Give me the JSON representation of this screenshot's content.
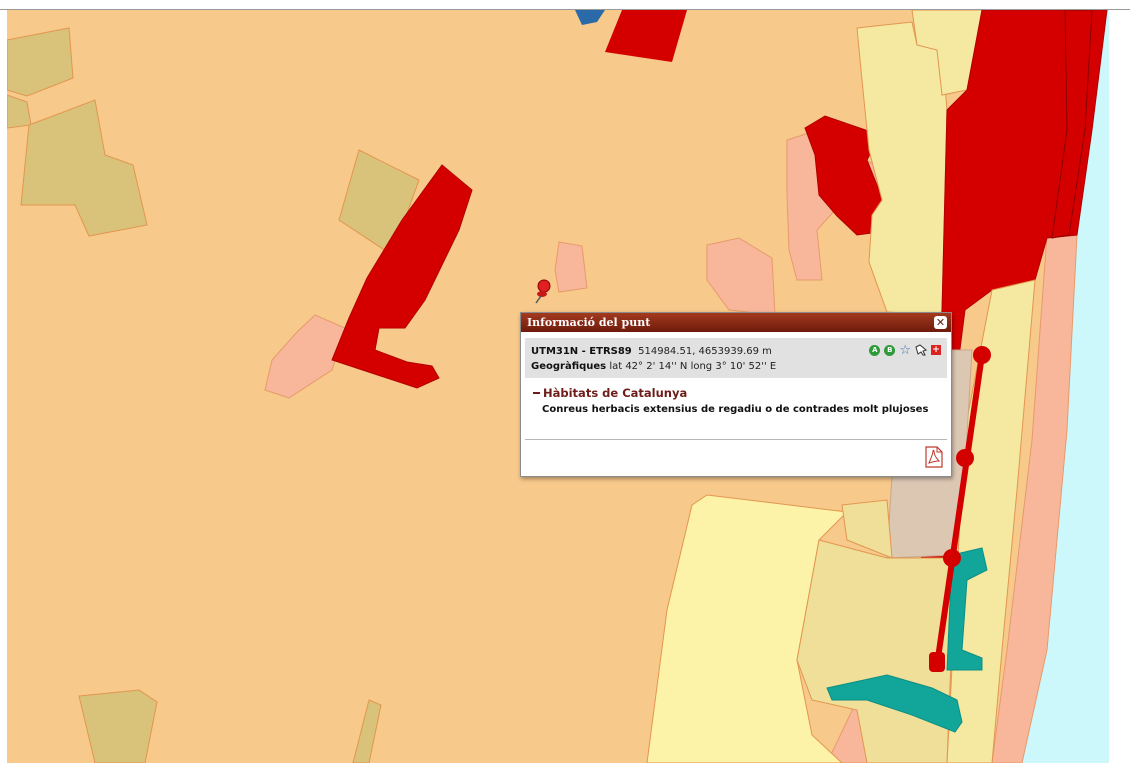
{
  "popup": {
    "title": "Informació del punt",
    "close_glyph": "✕",
    "utm_label": "UTM31N - ETRS89",
    "utm_value": "514984.51, 4653939.69 m",
    "geo_label": "Geogràfiques",
    "geo_value": "lat 42° 2' 14'' N long 3° 10' 52'' E",
    "tools": {
      "a_label": "A",
      "b_label": "B",
      "star_glyph": "☆",
      "plus_glyph": "+"
    },
    "section_title": "Hàbitats de Catalunya",
    "section_text": "Conreus herbacis extensius de regadiu o de contrades molt plujoses"
  },
  "icons": [
    "pushpin-icon",
    "close-icon",
    "a-icon",
    "b-icon",
    "star-icon",
    "pointer-icon",
    "plus-icon",
    "pdf-icon"
  ],
  "colors": {
    "map_background": "#f7c98a",
    "habitat_red": "#d40000",
    "habitat_olive": "#d9c27a",
    "habitat_pale_yellow": "#f5e8a0",
    "habitat_light_yellow": "#fdf3a8",
    "habitat_pink": "#f8b79a",
    "habitat_taupe": "#dcc7b3",
    "habitat_teal": "#12a59a",
    "sea": "#ccf8fc",
    "popup_header": "#8a2a14"
  }
}
